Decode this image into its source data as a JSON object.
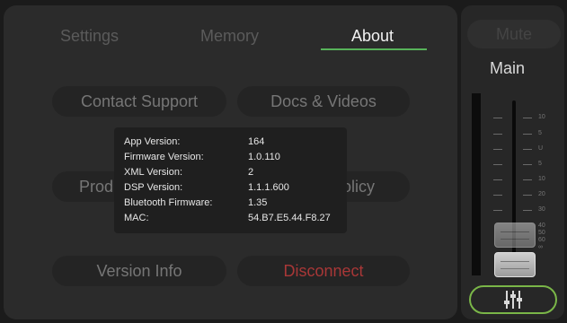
{
  "tabs": [
    {
      "label": "Settings"
    },
    {
      "label": "Memory"
    },
    {
      "label": "About"
    }
  ],
  "buttons": {
    "contact_support": "Contact Support",
    "docs_videos": "Docs & Videos",
    "product_partial": "Produ",
    "policy_partial": "olicy",
    "version_info": "Version Info",
    "disconnect": "Disconnect"
  },
  "info": {
    "rows": [
      {
        "label": "App Version:",
        "value": "164"
      },
      {
        "label": "Firmware Version:",
        "value": "1.0.110"
      },
      {
        "label": "XML Version:",
        "value": "2"
      },
      {
        "label": "DSP Version:",
        "value": "1.1.1.600"
      },
      {
        "label": "Bluetooth Firmware:",
        "value": "1.35"
      },
      {
        "label": "MAC:",
        "value": "54.B7.E5.44.F8.27"
      }
    ]
  },
  "side": {
    "mute_label": "Mute",
    "channel_label": "Main",
    "scale": [
      "10",
      "5",
      "U",
      "5",
      "10",
      "20",
      "30",
      "40",
      "50",
      "60",
      "∞"
    ]
  },
  "colors": {
    "accent_green": "#57b35a",
    "danger_red": "#a83737"
  },
  "icons": {
    "eq": "mixer-sliders-icon"
  }
}
